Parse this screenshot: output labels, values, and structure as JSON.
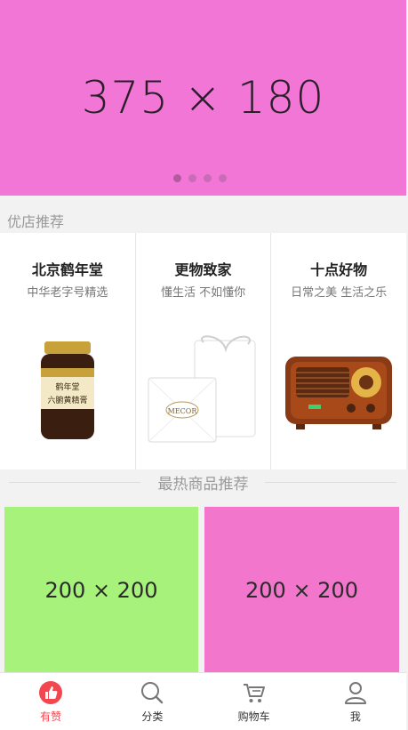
{
  "banner": {
    "text": "375 × 180"
  },
  "shop_section": {
    "title": "优店推荐"
  },
  "stores": [
    {
      "name": "北京鹤年堂",
      "subtitle": "中华老字号精选"
    },
    {
      "name": "更物致家",
      "subtitle": "懂生活 不如懂你"
    },
    {
      "name": "十点好物",
      "subtitle": "日常之美 生活之乐"
    }
  ],
  "store_images": {
    "jar_label": "鹤年堂",
    "jar_text": "六腑黄精膏",
    "box_text": "MECOR"
  },
  "hot_section": {
    "title": "最热商品推荐"
  },
  "products": [
    {
      "text": "200 × 200"
    },
    {
      "text": "200 × 200"
    }
  ],
  "tabbar": {
    "items": [
      {
        "label": "有赞",
        "icon": "thumb-up-icon"
      },
      {
        "label": "分类",
        "icon": "search-icon"
      },
      {
        "label": "购物车",
        "icon": "cart-icon"
      },
      {
        "label": "我",
        "icon": "user-icon"
      }
    ]
  },
  "colors": {
    "banner_bg": "#f176d6",
    "product_green": "#a6f27a",
    "product_pink": "#f176cc",
    "accent": "#f3464f"
  }
}
